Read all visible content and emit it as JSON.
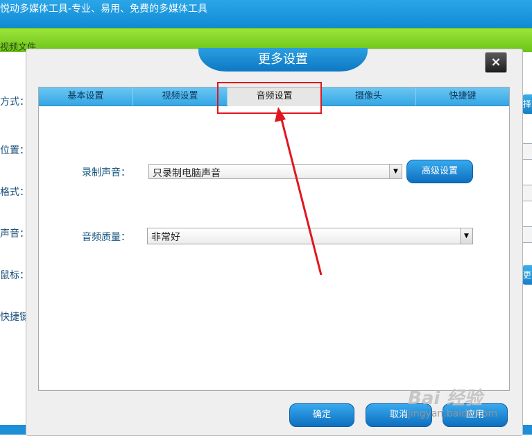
{
  "app": {
    "title": "悦动多媒体工具-专业、易用、免费的多媒体工具",
    "tab_label": "视频文件",
    "side_labels": [
      "方式：",
      "位置：",
      "格式：",
      "声音：",
      "鼠标：",
      "快捷键"
    ],
    "right_button_1": "择",
    "right_button_2": "更"
  },
  "dialog": {
    "title": "更多设置",
    "close_symbol": "×",
    "tabs": [
      "基本设置",
      "视频设置",
      "音频设置",
      "摄像头",
      "快捷键"
    ],
    "active_tab": "音频设置",
    "record_sound": {
      "label": "录制声音：",
      "value": "只录制电脑声音",
      "advanced_button": "高级设置"
    },
    "audio_quality": {
      "label": "音频质量：",
      "value": "非常好"
    },
    "buttons": {
      "ok": "确定",
      "cancel": "取消",
      "apply": "应用"
    }
  },
  "watermark": {
    "brand": "Bai 经验",
    "url": "jingyan.baidu.com"
  },
  "colors": {
    "highlight": "#e0161e",
    "accent_blue": "#108ad4",
    "tab_green": "#7ccf22"
  }
}
